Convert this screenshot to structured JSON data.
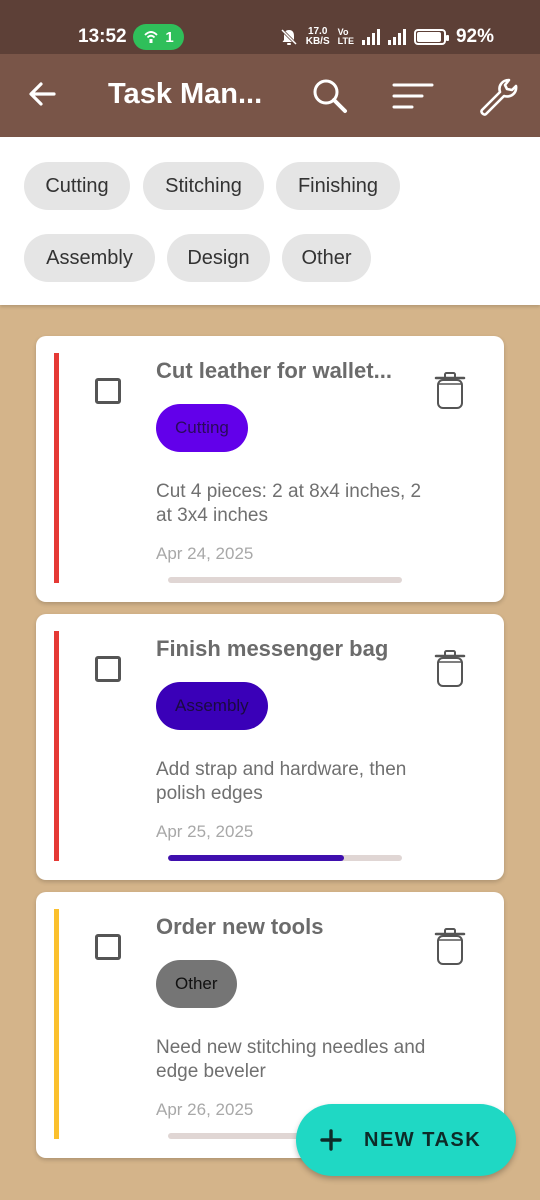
{
  "status_bar": {
    "time": "13:52",
    "hotspot_count": "1",
    "net_speed_value": "17.0",
    "net_speed_unit": "KB/S",
    "battery_percent": "92%"
  },
  "app_bar": {
    "title": "Task Man...",
    "back_icon": "arrow-back-icon",
    "actions": [
      "search-icon",
      "sort-icon",
      "wrench-icon"
    ]
  },
  "filters": [
    "Cutting",
    "Stitching",
    "Finishing",
    "Assembly",
    "Design",
    "Other"
  ],
  "tasks": [
    {
      "title": "Cut leather for wallet...",
      "category": "Cutting",
      "category_color": "#6200ea",
      "priority_color": "#e53935",
      "description": "Cut 4 pieces: 2 at 8x4 inches, 2 at 3x4 inches",
      "date": "Apr 24, 2025",
      "progress": 0
    },
    {
      "title": "Finish messenger bag",
      "category": "Assembly",
      "category_color": "#3a00b8",
      "priority_color": "#e53935",
      "description": "Add strap and hardware, then polish edges",
      "date": "Apr 25, 2025",
      "progress": 0.75
    },
    {
      "title": "Order new tools",
      "category": "Other",
      "category_color": "#757575",
      "priority_color": "#fbc02d",
      "description": "Need new stitching needles and edge beveler",
      "date": "Apr 26, 2025",
      "progress": 0
    }
  ],
  "fab": {
    "label": "NEW TASK",
    "icon": "plus-icon"
  }
}
